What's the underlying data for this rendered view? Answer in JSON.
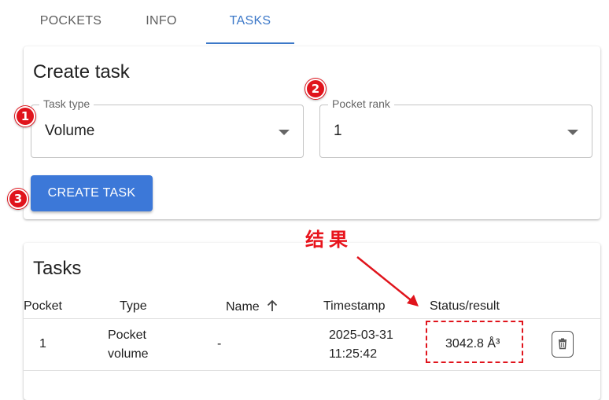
{
  "tabs": [
    {
      "label": "POCKETS"
    },
    {
      "label": "INFO"
    },
    {
      "label": "TASKS",
      "active": true
    }
  ],
  "create_card": {
    "title": "Create task",
    "task_type": {
      "label": "Task type",
      "value": "Volume"
    },
    "pocket_rank": {
      "label": "Pocket rank",
      "value": "1"
    },
    "button_label": "CREATE TASK"
  },
  "annotations": {
    "badges": [
      "1",
      "2",
      "3"
    ],
    "result_label": "结果",
    "color": "#e0141c"
  },
  "tasks_card": {
    "title": "Tasks",
    "columns": [
      "Pocket",
      "Type",
      "Name",
      "Timestamp",
      "Status/result"
    ],
    "sort_icon": "arrow-up-icon",
    "rows": [
      {
        "pocket": "1",
        "type_line1": "Pocket",
        "type_line2": "volume",
        "name": "-",
        "timestamp_date": "2025-03-31",
        "timestamp_time": "11:25:42",
        "result": "3042.8 Å³"
      }
    ]
  },
  "colors": {
    "accent": "#3c78c8",
    "button": "#3c78d8"
  }
}
